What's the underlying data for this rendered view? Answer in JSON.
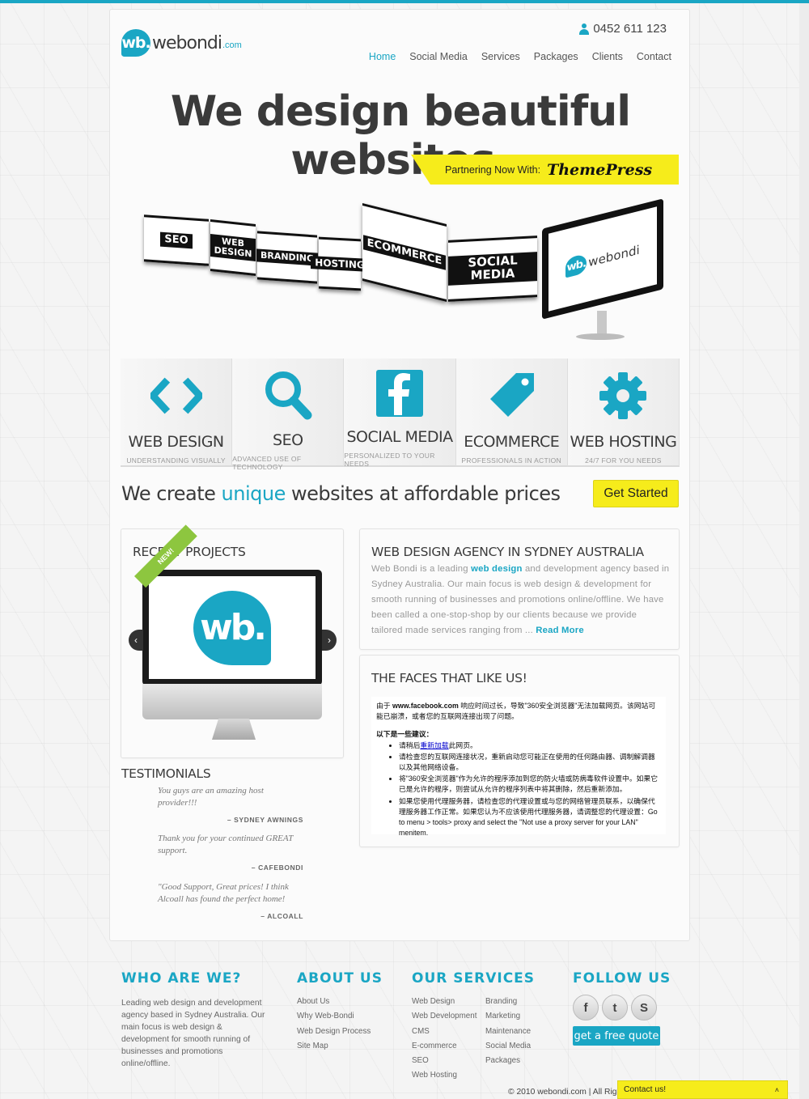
{
  "brand": {
    "logo_mark": "wb.",
    "logo_name": "webondi",
    "logo_tld": ".com",
    "accent_color": "#1aa6c4",
    "yellow": "#f6ec1b"
  },
  "header": {
    "phone": "0452 611 123",
    "nav": [
      "Home",
      "Social Media",
      "Services",
      "Packages",
      "Clients",
      "Contact"
    ],
    "active_nav": "Home"
  },
  "hero": {
    "title": "We design beautiful websites.",
    "partner_label": "Partnering Now With:",
    "partner_name": "ThemePress",
    "panels": [
      "SEO",
      "WEB DESIGN",
      "BRANDING",
      "HOSTING",
      "ECOMMERCE",
      "SOCIAL MEDIA"
    ]
  },
  "features": [
    {
      "title": "WEB DESIGN",
      "subtitle": "UNDERSTANDING VISUALLY",
      "icon": "code-icon"
    },
    {
      "title": "SEO",
      "subtitle": "ADVANCED USE OF TECHNOLOGY",
      "icon": "magnifier-icon"
    },
    {
      "title": "SOCIAL MEDIA",
      "subtitle": "PERSONALIZED TO YOUR NEEDS",
      "icon": "facebook-icon"
    },
    {
      "title": "ECOMMERCE",
      "subtitle": "PROFESSIONALS IN ACTION",
      "icon": "tag-icon"
    },
    {
      "title": "WEB HOSTING",
      "subtitle": "24/7 FOR YOU NEEDS",
      "icon": "gear-icon"
    }
  ],
  "tagline": {
    "before": "We create ",
    "accent": "unique",
    "after": " websites at affordable prices",
    "cta": "Get Started"
  },
  "recent_projects": {
    "title": "RECENT PROJECTS",
    "ribbon": "NEW!"
  },
  "testimonials": {
    "title": "TESTIMONIALS",
    "items": [
      {
        "quote": "You guys are an amazing host provider!!!",
        "author": "– SYDNEY AWNINGS"
      },
      {
        "quote": "Thank you for your continued GREAT support.",
        "author": "– CAFEBONDI"
      },
      {
        "quote": "\"Good Support, Great prices! I think Alcoall has found the perfect home!",
        "author": "– ALCOALL"
      }
    ]
  },
  "agency": {
    "title": "WEB DESIGN AGENCY IN SYDNEY AUSTRALIA",
    "text_1": "Web Bondi is a leading ",
    "highlight": "web design",
    "text_2": " and development agency based in Sydney Australia. Our main focus is web design & development for smooth running of businesses and promotions online/offline. We have been called a one-stop-shop by our clients because we provide tailored made services ranging from ... ",
    "read_more": "Read More"
  },
  "faces": {
    "title": "THE FACES THAT LIKE US!",
    "error_intro_bold": "www.facebook.com",
    "error_intro_pre": "由于 ",
    "error_intro_post": " 响应时间过长，导致\"360安全浏览器\"无法加载网页。该网站可能已崩溃，或者您的互联网连接出现了问题。",
    "suggest_title": "以下是一些建议：",
    "suggestions": [
      {
        "pre": "请稍后",
        "link": "重新加载",
        "post": "此网页。"
      },
      {
        "pre": "请检查您的互联网连接状况，重新启动您可能正在使用的任何路由器、调制解调器以及其他网络设备。",
        "link": "",
        "post": ""
      },
      {
        "pre": "将\"360安全浏览器\"作为允许的程序添加到您的防火墙或防病毒软件设置中。如果它已是允许的程序，则尝试从允许的程序列表中将其删除，然后重新添加。",
        "link": "",
        "post": ""
      },
      {
        "pre": "如果您使用代理服务器，请检查您的代理设置或与您的网络管理员联系，以确保代理服务器工作正常。如果您认为不应该使用代理服务器，请调整您的代理设置：Go to menu > tools> proxy and select the \"Not use a proxy server for your LAN\" menitem.",
        "link": "",
        "post": ""
      }
    ]
  },
  "footer": {
    "who_title": "WHO ARE WE?",
    "who_text": "Leading web design and development agency based in Sydney Australia. Our main focus is web design & development for smooth running of businesses and promotions online/offline.",
    "about_title": "ABOUT US",
    "about_links": [
      "About Us",
      "Why Web-Bondi",
      "Web Design Process",
      "Site Map"
    ],
    "services_title": "OUR SERVICES",
    "services_col1": [
      "Web Design",
      "Web Development",
      "CMS",
      "E-commerce",
      "SEO",
      "Web Hosting"
    ],
    "services_col2": [
      "Branding",
      "Marketing",
      "Maintenance",
      "Social Media",
      "Packages"
    ],
    "follow_title": "FOLLOW US",
    "social": [
      {
        "label": "f",
        "icon": "facebook-icon"
      },
      {
        "label": "t",
        "icon": "twitter-icon"
      },
      {
        "label": "S",
        "icon": "skype-icon"
      }
    ],
    "quote_button": "get a free quote",
    "copyright": "© 2010 webondi.com | All Righ",
    "contact_tab": "Contact us!"
  }
}
